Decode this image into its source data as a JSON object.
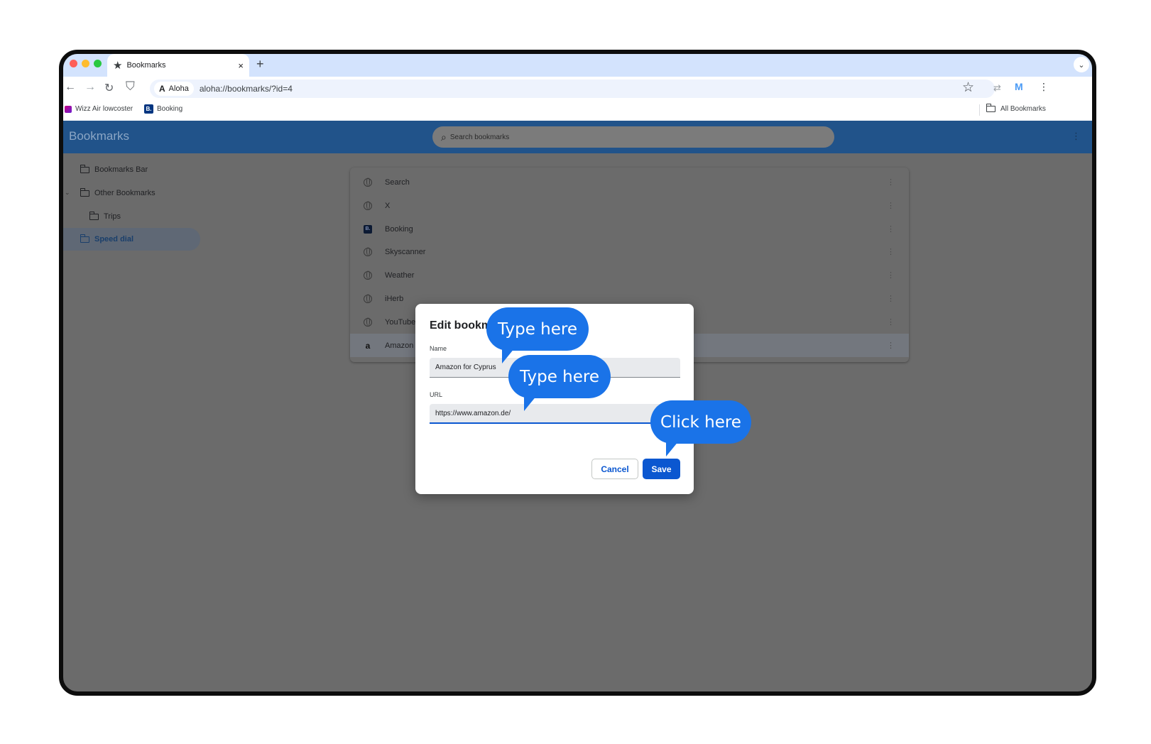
{
  "browser": {
    "tab_title": "Bookmarks",
    "tab_close": "×",
    "new_tab": "+",
    "chip_label": "Aloha",
    "url": "aloha://bookmarks/?id=4",
    "profile_initial": "M",
    "bookmarks_bar": [
      {
        "label": "Wizz Air lowcoster"
      },
      {
        "label": "Booking",
        "favicon_text": "B."
      }
    ],
    "all_bookmarks": "All Bookmarks"
  },
  "page": {
    "title": "Bookmarks",
    "search_placeholder": "Search bookmarks",
    "sidebar": [
      {
        "label": "Bookmarks Bar"
      },
      {
        "label": "Other Bookmarks"
      },
      {
        "label": "Trips"
      },
      {
        "label": "Speed dial",
        "active": true
      }
    ],
    "bookmarks": [
      {
        "label": "Search",
        "icon": "globe-icon"
      },
      {
        "label": "X",
        "icon": "globe-icon"
      },
      {
        "label": "Booking",
        "icon": "booking-icon",
        "favicon_text": "B."
      },
      {
        "label": "Skyscanner",
        "icon": "globe-icon"
      },
      {
        "label": "Weather",
        "icon": "globe-icon"
      },
      {
        "label": "iHerb",
        "icon": "globe-icon"
      },
      {
        "label": "YouTube",
        "icon": "globe-icon"
      },
      {
        "label": "Amazon",
        "icon": "amazon-icon",
        "favicon_text": "a",
        "selected": true
      }
    ]
  },
  "dialog": {
    "title": "Edit bookmark",
    "name_label": "Name",
    "name_value": "Amazon for Cyprus",
    "url_label": "URL",
    "url_value": "https://www.amazon.de/",
    "cancel_label": "Cancel",
    "save_label": "Save"
  },
  "callouts": [
    {
      "text": "Type here"
    },
    {
      "text": "Type here"
    },
    {
      "text": "Click here"
    }
  ],
  "colors": {
    "accent": "#0b57d0",
    "callout": "#1a73e8",
    "header": "#21538a"
  }
}
